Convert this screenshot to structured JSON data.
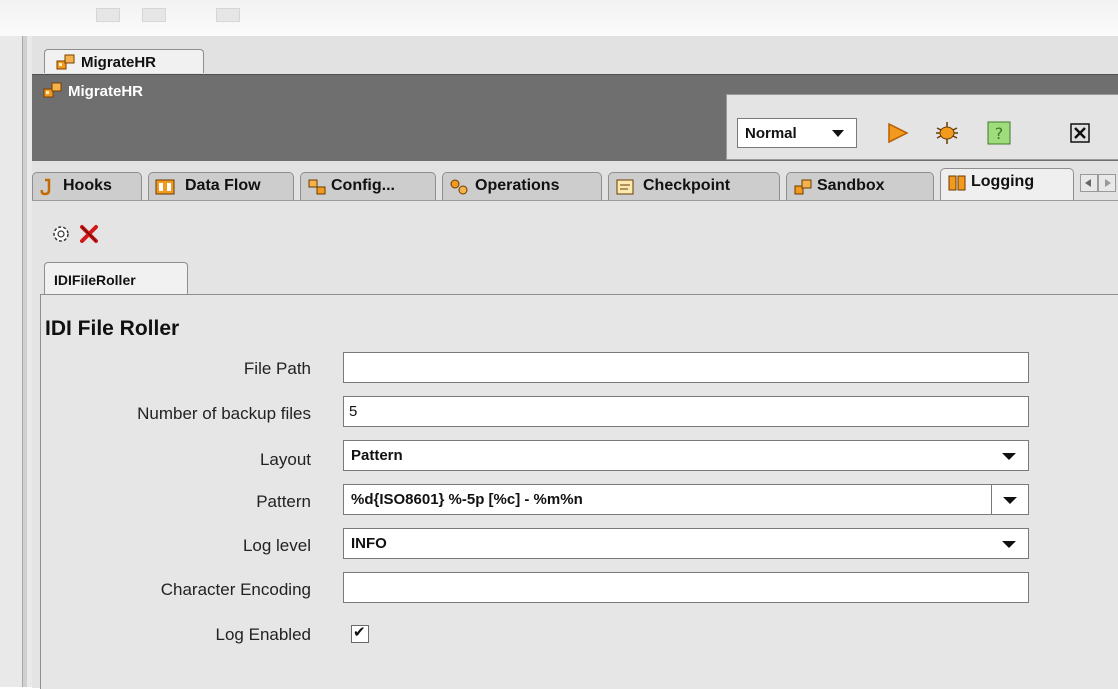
{
  "window": {
    "tab_title": "MigrateHR",
    "header_title": "MigrateHR",
    "run_mode": "Normal"
  },
  "icons": {
    "run": "play-icon",
    "debug": "bug-icon",
    "help": "help-icon",
    "close": "close-icon",
    "new": "gear-icon",
    "delete": "delete-icon"
  },
  "tabs": [
    {
      "label": "Hooks",
      "active": false
    },
    {
      "label": "Data Flow",
      "active": false
    },
    {
      "label": "Config...",
      "active": false
    },
    {
      "label": "Operations",
      "active": false
    },
    {
      "label": "Checkpoint",
      "active": false
    },
    {
      "label": "Sandbox",
      "active": false
    },
    {
      "label": "Logging",
      "active": true
    }
  ],
  "logger_tab": "IDIFileRoller",
  "form": {
    "title": "IDI File Roller",
    "file_path": {
      "label": "File Path",
      "value": ""
    },
    "backup_files": {
      "label": "Number of backup files",
      "value": "5"
    },
    "layout": {
      "label": "Layout",
      "value": "Pattern"
    },
    "pattern": {
      "label": "Pattern",
      "value": "%d{ISO8601} %-5p [%c] - %m%n"
    },
    "log_level": {
      "label": "Log level",
      "value": "INFO"
    },
    "encoding": {
      "label": "Character Encoding",
      "value": ""
    },
    "log_enabled": {
      "label": "Log Enabled",
      "checked": true
    }
  },
  "colors": {
    "header_bg": "#6f6f6f",
    "panel_bg": "#e2e2e2",
    "accent_orange": "#f39a1e"
  }
}
